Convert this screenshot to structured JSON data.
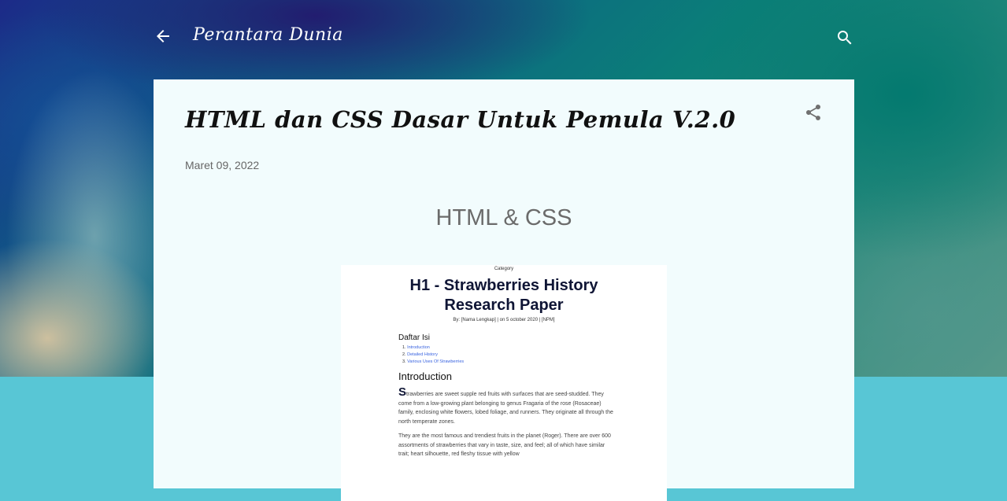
{
  "header": {
    "blog_title": "Perantara Dunia"
  },
  "post": {
    "title": "HTML dan CSS Dasar Untuk Pemula V.2.0",
    "date": "Maret 09, 2022",
    "content_heading": "HTML & CSS"
  },
  "doc_preview": {
    "category": "Category",
    "title": "H1 - Strawberries History Research Paper",
    "byline": "By: [Nama Lengkap] | on 5 october 2020 | [NPM]",
    "toc_title": "Daftar Isi",
    "toc": [
      {
        "num": "1.",
        "label": "Introduction"
      },
      {
        "num": "2.",
        "label": "Detailed History"
      },
      {
        "num": "3.",
        "label": "Various Uses Of Strawberries"
      }
    ],
    "section_title": "Introduction",
    "para1_dropcap": "S",
    "para1_text": "trawberries are sweet supple red fruits with surfaces that are seed-studded. They come from a low-growing plant belonging to genus Fragaria of the rose (Rosaceae) family, enclosing white flowers, lobed foliage, and runners. They originate all through the north temperate zones.",
    "para2_text": "They are the most famous and trendiest fruits in the planet (Roger). There are over 600 assortments of strawberries that vary in taste, size, and feel; all of which have similar trait; heart silhouette, red fleshy tissue with yellow"
  },
  "icons": {
    "back": "arrow-back-icon",
    "search": "search-icon",
    "share": "share-icon"
  },
  "colors": {
    "page_background": "#58c6d5",
    "card_background": "#f2fcfd",
    "doc_title": "#0f1535",
    "doc_link": "#3a64e0"
  }
}
